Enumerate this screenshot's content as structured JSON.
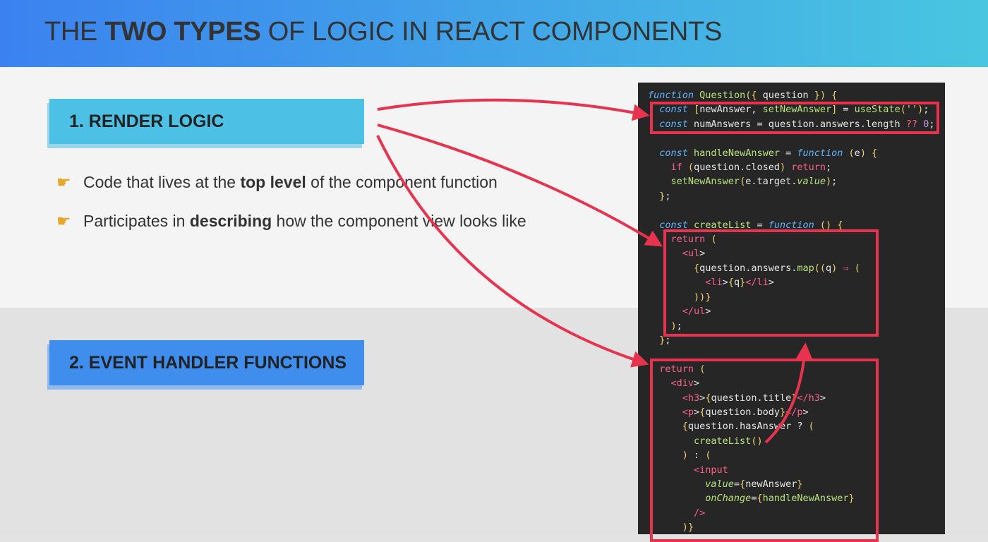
{
  "header": {
    "title_pre": "THE ",
    "title_bold": "TWO TYPES",
    "title_post": " OF LOGIC IN REACT COMPONENTS"
  },
  "sections": {
    "render_logic": "1. RENDER LOGIC",
    "event_handlers": "2. EVENT HANDLER FUNCTIONS"
  },
  "bullets": [
    {
      "icon": "pointing-hand-icon",
      "pre": "Code that lives at the ",
      "bold": "top level",
      "post": " of the component function"
    },
    {
      "icon": "pointing-hand-icon",
      "pre": "Participates in ",
      "bold": "describing",
      "post": " how the component view looks like"
    }
  ],
  "code_lines": [
    "function Question({ question }) {",
    "  const [newAnswer, setNewAnswer] = useState('');",
    "  const numAnswers = question.answers.length ?? 0;",
    "",
    "  const handleNewAnswer = function (e) {",
    "    if (question.closed) return;",
    "    setNewAnswer(e.target.value);",
    "  };",
    "",
    "  const createList = function () {",
    "    return (",
    "      <ul>",
    "        {question.answers.map((q) ⇒ (",
    "          <li>{q}</li>",
    "        ))}",
    "      </ul>",
    "    );",
    "  };",
    "",
    "  return (",
    "    <div>",
    "      <h3>{question.title}</h3>",
    "      <p>{question.body}</p>",
    "      {question.hasAnswer ? (",
    "        createList()",
    "      ) : (",
    "        <input",
    "          value={newAnswer}",
    "          onChange={handleNewAnswer}",
    "        />",
    "      )}"
  ],
  "colors": {
    "accent_red": "#e8334e",
    "render_box": "#4cc1e5",
    "event_box": "#3f8ded"
  }
}
